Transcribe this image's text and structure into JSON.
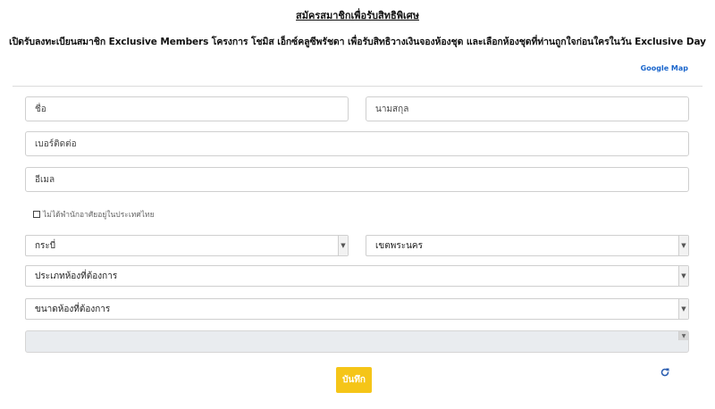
{
  "header": {
    "title": "สมัครสมาชิกเพื่อรับสิทธิพิเศษ",
    "subtitle": "เปิดรับลงทะเบียนสมาชิก Exclusive Members โครงการ โชมิส เอ็กซ์คลูซีพรัชดา เพื่อรับสิทธิวางเงินจองห้องชุด และเลือกห้องชุดที่ท่านถูกใจก่อนใครในวัน Exclusive Day",
    "map_link": "Google Map"
  },
  "form": {
    "first_name_placeholder": "ชื่อ",
    "last_name_placeholder": "นามสกุล",
    "phone_placeholder": "เบอร์ติดต่อ",
    "email_placeholder": "อีเมล",
    "not_thai_resident_label": "ไม่ได้พำนักอาศัยอยู่ในประเทศไทย",
    "province_selected": "กระบี่",
    "district_selected": "เขตพระนคร",
    "room_type_selected": "ประเภทห้องที่ต้องการ",
    "room_size_selected": "ขนาดห้องที่ต้องการ",
    "save_label": "บันทึก"
  },
  "icons": {
    "dropdown": "chevron-down-icon",
    "refresh": "refresh-icon"
  },
  "colors": {
    "accent": "#f5c518",
    "link": "#1a66cc",
    "refresh": "#2a5db0"
  }
}
